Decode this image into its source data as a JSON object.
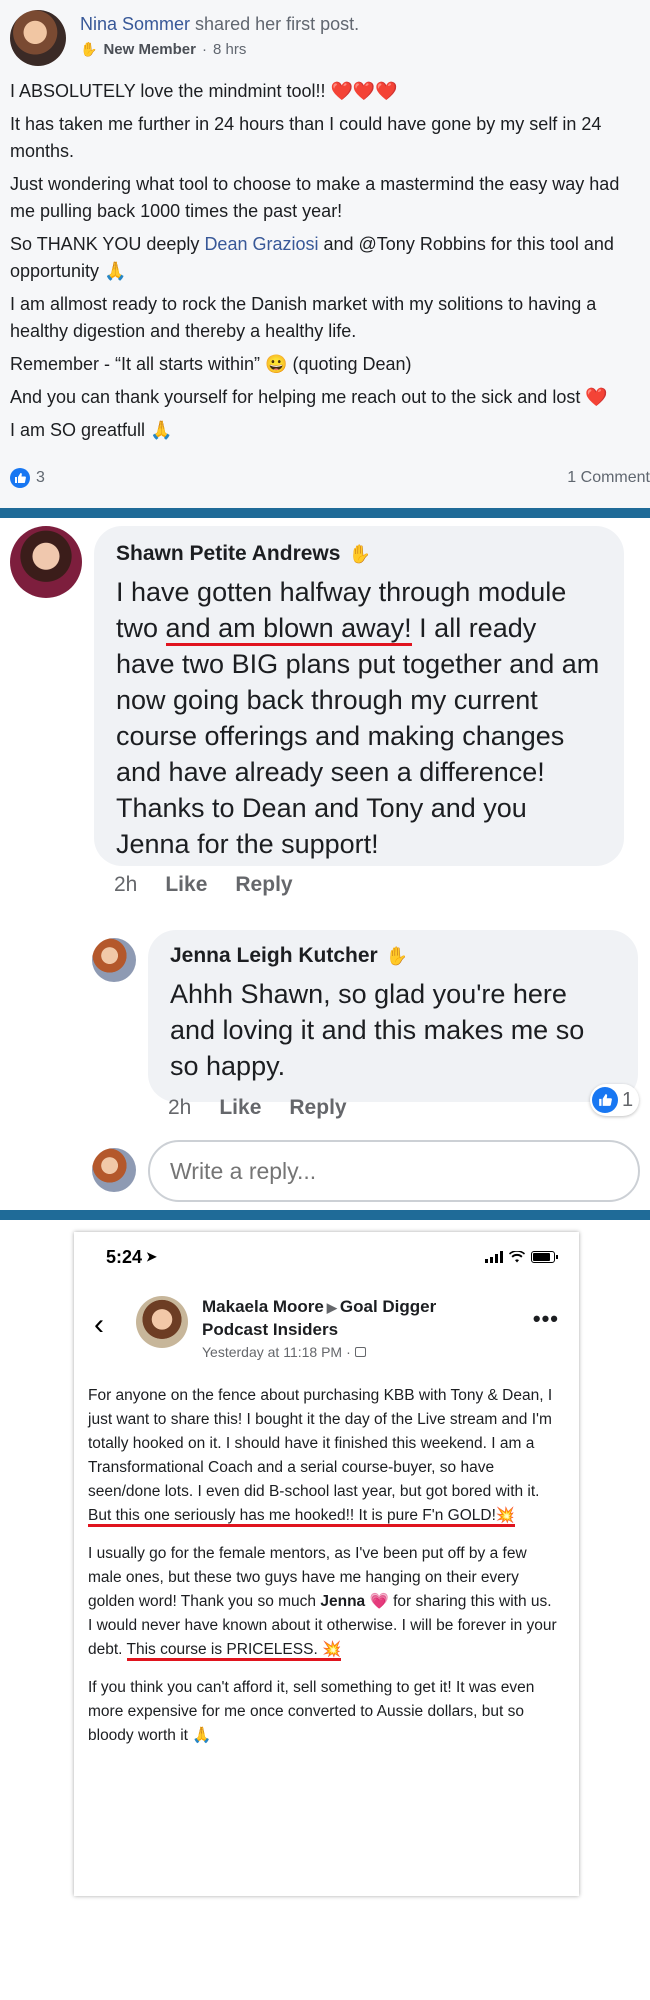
{
  "post": {
    "author": "Nina Sommer",
    "action": "shared her first post.",
    "badge": "New Member",
    "time": "8 hrs",
    "paragraphs": {
      "p1": "I ABSOLUTELY love the mindmint tool!! ❤️❤️❤️",
      "p2": "It has taken me further in 24 hours than I could have gone by my self in 24 months.",
      "p3": "Just wondering what tool to choose to make a mastermind the easy way had me pulling back 1000 times the past year!",
      "p4_before": "So THANK YOU deeply ",
      "p4_link": "Dean Graziosi",
      "p4_after": " and @Tony Robbins for this tool and opportunity 🙏",
      "p5": "I am allmost ready to rock the Danish market with my solitions to having a healthy digestion and thereby a healthy life.",
      "p6": "Remember - “It all starts within” 😀 (quoting Dean)",
      "p7": "And you can thank yourself for helping me reach out to the sick and lost ❤️",
      "p8": "I am SO greatfull 🙏"
    },
    "like_count": "3",
    "comment_count": "1 Comment"
  },
  "comments": {
    "shawn": {
      "name": "Shawn Petite Andrews",
      "text_before": "I have gotten halfway through module two ",
      "text_highlight": "and am blown away!",
      "text_after": " I all ready have two BIG plans put together and am now going back through my current course offerings and making changes and have already seen a difference! Thanks to Dean and Tony and you Jenna for the support!",
      "time": "2h",
      "like": "Like",
      "reply": "Reply"
    },
    "jenna": {
      "name": "Jenna Leigh Kutcher",
      "text": "Ahhh Shawn, so glad you're here and loving it and this makes me so so happy.",
      "time": "2h",
      "like": "Like",
      "reply": "Reply",
      "reaction_count": "1"
    },
    "reply_placeholder": "Write a reply..."
  },
  "phone": {
    "clock": "5:24",
    "author": "Makaela Moore",
    "group": "Goal Digger Podcast Insiders",
    "time": "Yesterday at 11:18 PM",
    "p1_before": "For anyone on the fence about purchasing KBB with Tony & Dean, I just want to share this! I bought it the day of the Live stream and I'm totally hooked on it. I should have it finished this weekend. I am a Transformational Coach and a serial course-buyer, so have seen/done lots. I even did B-school last year, but got bored with it. ",
    "p1_highlight": "But this one seriously has me hooked!! It is pure F'n GOLD!💥",
    "p2_before": "I usually go for the female mentors, as I've been put off by a few male ones, but these two guys have me hanging on their every golden word! Thank you so much ",
    "p2_name": "Jenna",
    "p2_mid": " 💗 for sharing this with us. I would never have known about it otherwise. I will be forever in your debt. ",
    "p2_highlight": "This course is PRICELESS. 💥",
    "p3": "If you think you can't afford it, sell something to get it! It was even more expensive for me once converted to Aussie dollars, but so bloody worth it 🙏"
  },
  "colors": {
    "link_blue": "#385898",
    "divider": "#1f6b98",
    "underline_red": "#e0141e",
    "like_blue": "#1877f2"
  }
}
